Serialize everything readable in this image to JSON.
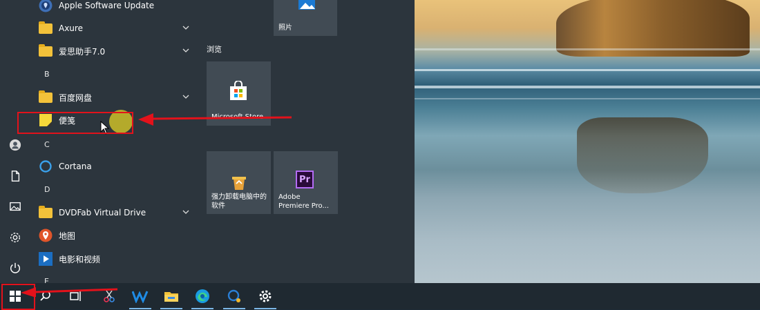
{
  "start_menu": {
    "apps": [
      {
        "label": "Apple Software Update",
        "type": "app",
        "icon": "apple-update-icon"
      },
      {
        "label": "Axure",
        "type": "folder",
        "icon": "folder-icon"
      },
      {
        "label": "爱思助手7.0",
        "type": "folder",
        "icon": "folder-icon"
      },
      {
        "label": "百度网盘",
        "type": "folder",
        "icon": "folder-icon"
      },
      {
        "label": "便笺",
        "type": "app",
        "icon": "sticky-notes-icon"
      },
      {
        "label": "Cortana",
        "type": "app",
        "icon": "cortana-icon"
      },
      {
        "label": "DVDFab Virtual Drive",
        "type": "folder",
        "icon": "folder-icon"
      },
      {
        "label": "地图",
        "type": "app",
        "icon": "maps-icon"
      },
      {
        "label": "电影和视频",
        "type": "app",
        "icon": "movies-icon"
      }
    ],
    "letters": {
      "b": "B",
      "c": "C",
      "d": "D",
      "e": "E"
    },
    "tiles": {
      "photos": "照片",
      "group_browse": "浏览",
      "store": "Microsoft Store",
      "uninstall": "强力卸载电脑中的软件",
      "premiere_line1": "Adobe",
      "premiere_line2": "Premiere Pro...",
      "premiere_badge": "Pr"
    }
  },
  "colors": {
    "highlight": "#e3121b",
    "cursor": "#cdbe28",
    "menu_bg": "#2c353d",
    "taskbar_bg": "#1f2931"
  },
  "taskbar": [
    "windows-start-icon",
    "search-icon",
    "task-view-icon",
    "snipping-tool-icon",
    "wps-writer-icon",
    "file-explorer-icon",
    "edge-icon",
    "photo-viewer-icon",
    "settings-icon"
  ]
}
